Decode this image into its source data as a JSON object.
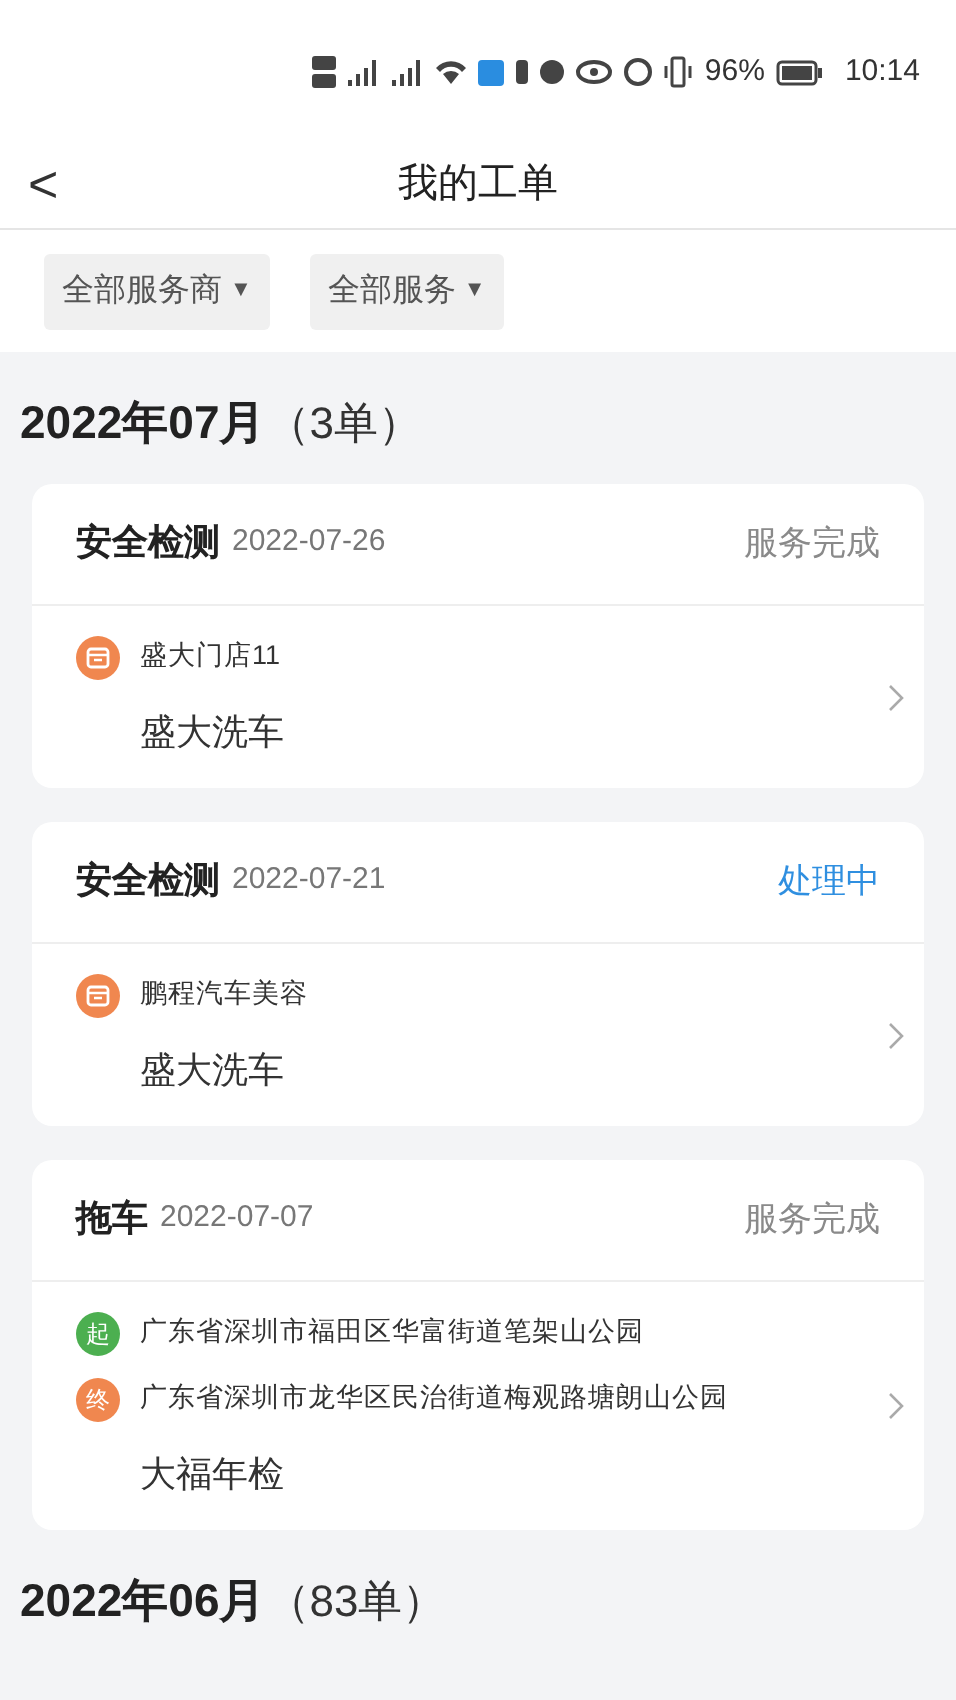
{
  "status_bar": {
    "battery_text": "96%",
    "time": "10:14"
  },
  "header": {
    "back": "<",
    "title": "我的工单"
  },
  "filters": [
    {
      "label": "全部服务商",
      "caret": "▼"
    },
    {
      "label": "全部服务",
      "caret": "▼"
    }
  ],
  "groups": [
    {
      "month": "2022年07月",
      "count": "（3单）",
      "orders": [
        {
          "type": "安全检测",
          "date": "2022-07-26",
          "status": "服务完成",
          "kind": "done",
          "lines": [
            {
              "kind": "shop",
              "text": "盛大门店11"
            }
          ],
          "provider": "盛大洗车"
        },
        {
          "type": "安全检测",
          "date": "2022-07-21",
          "status": "处理中",
          "kind": "processing",
          "lines": [
            {
              "kind": "shop",
              "text": "鹏程汽车美容"
            }
          ],
          "provider": "盛大洗车"
        },
        {
          "type": "拖车",
          "date": "2022-07-07",
          "status": "服务完成",
          "kind": "done",
          "lines": [
            {
              "kind": "start",
              "badge": "起",
              "text": "广东省深圳市福田区华富街道笔架山公园"
            },
            {
              "kind": "end",
              "badge": "终",
              "text": "广东省深圳市龙华区民治街道梅观路塘朗山公园"
            }
          ],
          "provider": "大福年检"
        }
      ]
    },
    {
      "month": "2022年06月",
      "count": "（83单）"
    }
  ]
}
